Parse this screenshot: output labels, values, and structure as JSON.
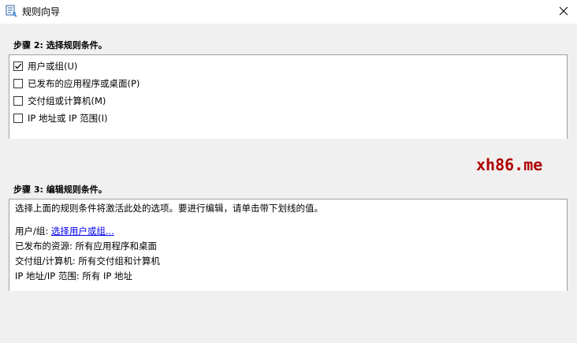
{
  "window": {
    "title": "规则向导"
  },
  "step2": {
    "label": "步骤 2: 选择规则条件。",
    "conditions": [
      {
        "label": "用户或组(U)",
        "checked": true
      },
      {
        "label": "已发布的应用程序或桌面(P)",
        "checked": false
      },
      {
        "label": "交付组或计算机(M)",
        "checked": false
      },
      {
        "label": "IP 地址或 IP 范围(I)",
        "checked": false
      }
    ]
  },
  "watermark": "xh86.me",
  "step3": {
    "label": "步骤 3: 编辑规则条件。",
    "instructions": "选择上面的规则条件将激活此处的选项。要进行编辑，请单击带下划线的值。",
    "user_group_prefix": "用户/组: ",
    "user_group_link": "选择用户或组...",
    "resources_line": "已发布的资源: 所有应用程序和桌面",
    "delivery_line": "交付组/计算机: 所有交付组和计算机",
    "ip_line": "IP 地址/IP 范围: 所有 IP 地址"
  },
  "icons": {
    "app": "wizard-app-icon",
    "close": "close-icon",
    "check": "checkmark-icon"
  }
}
